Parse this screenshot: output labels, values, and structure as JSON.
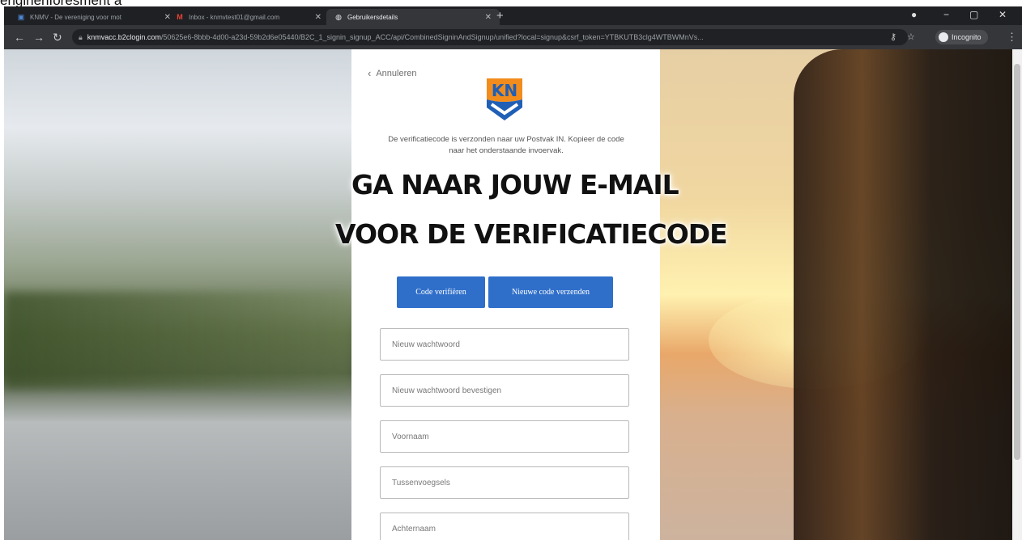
{
  "caption": "enginenforesment a",
  "browser": {
    "tabs": [
      {
        "title": "KNMV - De vereniging voor mot",
        "favicon": "knmv-favicon",
        "active": false
      },
      {
        "title": "Inbox - knmvtest01@gmail.com",
        "favicon": "gmail-icon",
        "active": false
      },
      {
        "title": "Gebruikersdetails",
        "favicon": "globe-icon",
        "active": true
      }
    ],
    "address": {
      "host": "knmvacc.b2clogin.com",
      "path": "/50625e6-8bbb-4d00-a23d-59b2d6e05440/B2C_1_signin_signup_ACC/api/CombinedSigninAndSignup/unified?local=signup&csrf_token=YTBKUTB3clg4WTBWMnVs..."
    },
    "incognito_label": "Incognito"
  },
  "form": {
    "cancel_label": "Annuleren",
    "verification_text": "De verificatiecode is verzonden naar uw Postvak IN. Kopieer de code naar het onderstaande invoervak.",
    "overlay_line1": "GA NAAR JOUW E-MAIL",
    "overlay_line2": "VOOR DE VERIFICATIECODE",
    "verify_button": "Code verifiëren",
    "resend_button": "Nieuwe code verzenden",
    "fields": {
      "new_password": "Nieuw wachtwoord",
      "confirm_password": "Nieuw wachtwoord bevestigen",
      "first_name": "Voornaam",
      "infix": "Tussenvoegsels",
      "last_name": "Achternaam"
    }
  },
  "colors": {
    "primary_button": "#2f6fca",
    "logo_orange": "#f28c1c",
    "logo_blue": "#1f5fb5"
  }
}
